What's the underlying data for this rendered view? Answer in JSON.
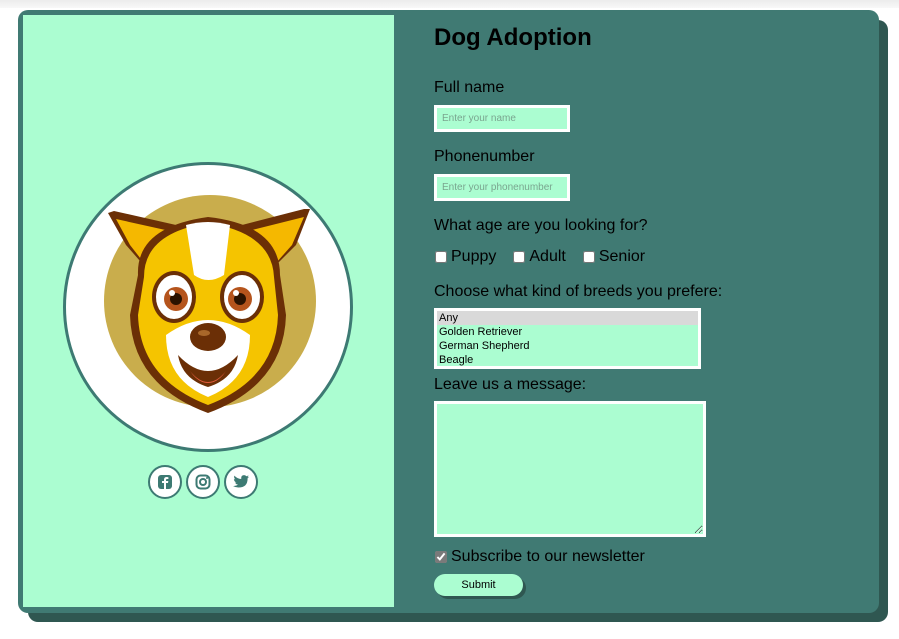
{
  "form": {
    "title": "Dog Adoption",
    "full_name_label": "Full name",
    "full_name_placeholder": "Enter your name",
    "phone_label": "Phonenumber",
    "phone_placeholder": "Enter your phonenumber",
    "age_question": "What age are you looking for?",
    "age_options": [
      "Puppy",
      "Adult",
      "Senior"
    ],
    "breed_question": "Choose what kind of breeds you prefere:",
    "breed_options": [
      "Any",
      "Golden Retriever",
      "German Shepherd",
      "Beagle"
    ],
    "breed_selected": "Any",
    "message_label": "Leave us a message:",
    "newsletter_label": "Subscribe to our newsletter",
    "newsletter_checked": true,
    "submit_label": "Submit"
  },
  "socials": [
    "facebook-icon",
    "instagram-icon",
    "twitter-icon"
  ],
  "colors": {
    "card": "#407a73",
    "card_shadow": "#2f5751",
    "mint": "#abfdd1",
    "circle_border": "#3d7a73"
  }
}
